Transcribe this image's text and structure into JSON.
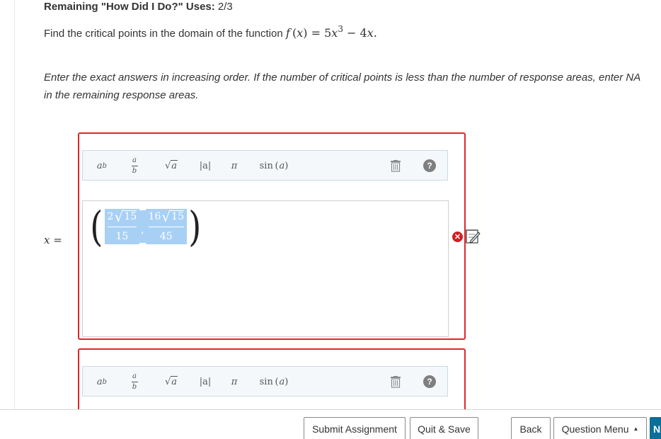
{
  "header": {
    "remaining_label": "Remaining \"How Did I Do?\" Uses:",
    "remaining_value": "2/3"
  },
  "question": {
    "prompt": "Find the critical points in the domain of the function",
    "function_name": "f",
    "function_var": "x",
    "rhs_coef1": "5",
    "rhs_var1": "x",
    "rhs_exp": "3",
    "rhs_op": "−",
    "rhs_coef2": "4",
    "rhs_var2": "x",
    "period": "."
  },
  "instructions": "Enter the exact answers in increasing order. If the number of critical points is less than the number of response areas, enter NA in the remaining response areas.",
  "answer_label": {
    "var": "x",
    "eq": "="
  },
  "toolbar": {
    "exponent_base": "a",
    "exponent_power": "b",
    "fraction_num": "a",
    "fraction_den": "b",
    "sqrt_arg": "a",
    "abs_label": "|a|",
    "pi_label": "π",
    "sin_label": "sin",
    "sin_arg": "a",
    "help_label": "?"
  },
  "answer": {
    "frac1_coef": "2",
    "frac1_radicand": "15",
    "frac1_den": "15",
    "separator": ",",
    "frac2_coef": "16",
    "frac2_radicand": "15",
    "frac2_den": "45"
  },
  "status": {
    "result": "incorrect",
    "color": "#cf1f25"
  },
  "footer": {
    "submit": "Submit Assignment",
    "quit": "Quit & Save",
    "back": "Back",
    "menu": "Question Menu",
    "next_partial": "N"
  },
  "colors": {
    "response_border": "#e0262a",
    "selection": "#a8d0f5",
    "next_button": "#0b6f98"
  }
}
